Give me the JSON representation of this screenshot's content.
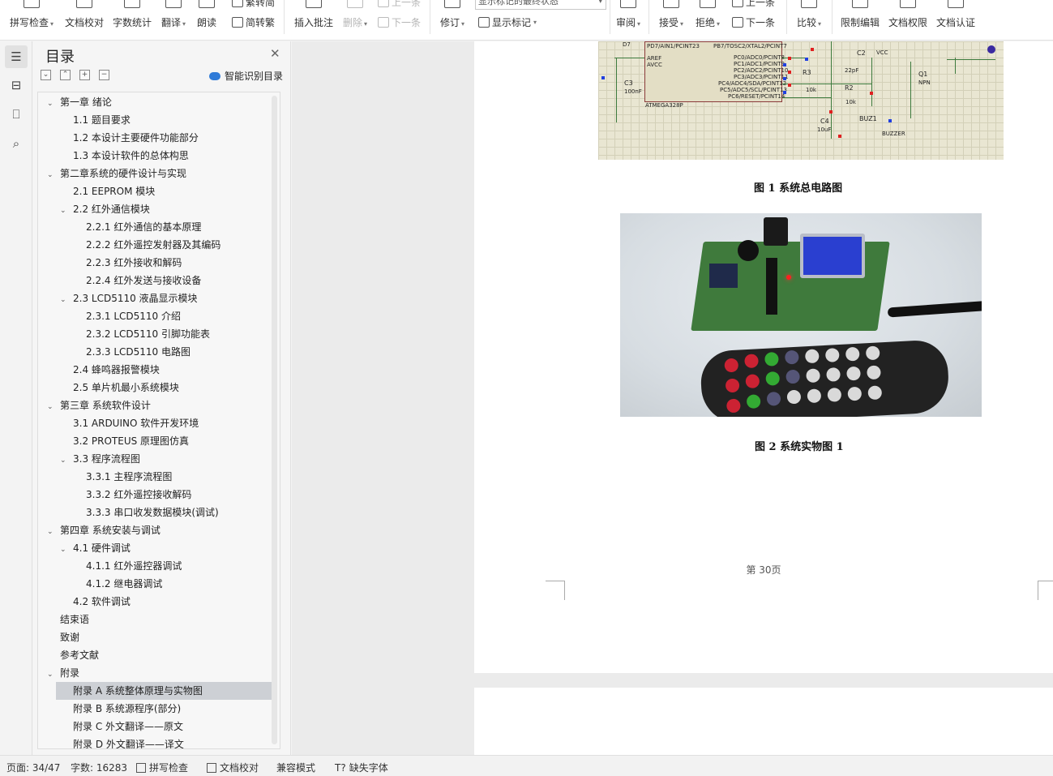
{
  "ribbon": {
    "spell_check": "拼写检查",
    "doc_proofread": "文档校对",
    "word_count": "字数统计",
    "translate": "翻译",
    "read_aloud": "朗读",
    "trad_to_simp": "繁转简",
    "simp_to_trad": "简转繁",
    "insert_comment": "插入批注",
    "delete": "删除",
    "prev_comment": "上一条",
    "next_comment": "下一条",
    "revise": "修订",
    "markup_state": "显示标记的最终状态",
    "show_markup": "显示标记",
    "review": "审阅",
    "accept": "接受",
    "reject": "拒绝",
    "prev_change": "上一条",
    "next_change": "下一条",
    "compare": "比较",
    "restrict_edit": "限制编辑",
    "doc_permission": "文档权限",
    "doc_cert": "文档认证"
  },
  "toc": {
    "title": "目录",
    "smart_toc": "智能识别目录",
    "items": [
      {
        "text": "第一章  绪论",
        "level": 0,
        "expanded": true
      },
      {
        "text": "1.1    题目要求",
        "level": 1
      },
      {
        "text": "1.2    本设计主要硬件功能部分",
        "level": 1
      },
      {
        "text": "1.3    本设计软件的总体构思",
        "level": 1
      },
      {
        "text": "第二章系统的硬件设计与实现",
        "level": 0,
        "expanded": true
      },
      {
        "text": "2.1    EEPROM 模块",
        "level": 1
      },
      {
        "text": "2.2    红外通信模块",
        "level": 1,
        "expanded": true
      },
      {
        "text": "2.2.1    红外通信的基本原理",
        "level": 2
      },
      {
        "text": "2.2.2    红外遥控发射器及其编码",
        "level": 2
      },
      {
        "text": "2.2.3    红外接收和解码",
        "level": 2
      },
      {
        "text": "2.2.4    红外发送与接收设备",
        "level": 2
      },
      {
        "text": "2.3    LCD5110 液晶显示模块",
        "level": 1,
        "expanded": true
      },
      {
        "text": "2.3.1    LCD5110 介绍",
        "level": 2
      },
      {
        "text": "2.3.2    LCD5110 引脚功能表",
        "level": 2
      },
      {
        "text": "2.3.3    LCD5110 电路图",
        "level": 2
      },
      {
        "text": "2.4      蜂鸣器报警模块",
        "level": 1
      },
      {
        "text": "2.5    单片机最小系统模块",
        "level": 1
      },
      {
        "text": "第三章  系统软件设计",
        "level": 0,
        "expanded": true
      },
      {
        "text": "3.1    ARDUINO 软件开发环境",
        "level": 1
      },
      {
        "text": "3.2    PROTEUS 原理图仿真",
        "level": 1
      },
      {
        "text": "3.3    程序流程图",
        "level": 1,
        "expanded": true
      },
      {
        "text": "3.3.1    主程序流程图",
        "level": 2
      },
      {
        "text": "3.3.2    红外遥控接收解码",
        "level": 2
      },
      {
        "text": "3.3.3    串口收发数据模块(调试)",
        "level": 2
      },
      {
        "text": "第四章  系统安装与调试",
        "level": 0,
        "expanded": true
      },
      {
        "text": "4.1    硬件调试",
        "level": 1,
        "expanded": true
      },
      {
        "text": "4.1.1 红外遥控器调试",
        "level": 2
      },
      {
        "text": "4.1.2 继电器调试",
        "level": 2
      },
      {
        "text": "4.2    软件调试",
        "level": 1
      },
      {
        "text": "结束语",
        "level": 0
      },
      {
        "text": "致谢",
        "level": 0
      },
      {
        "text": "参考文献",
        "level": 0
      },
      {
        "text": "附录",
        "level": 0,
        "expanded": true
      },
      {
        "text": "附录 A    系统整体原理与实物图",
        "level": 1,
        "selected": true
      },
      {
        "text": "附录 B    系统源程序(部分)",
        "level": 1
      },
      {
        "text": "附录 C    外文翻译——原文",
        "level": 1
      },
      {
        "text": "附录 D    外文翻译——译文",
        "level": 1
      }
    ]
  },
  "doc": {
    "fig1_caption": "图 1  系统总电路图",
    "fig2_caption": "图 2  系统实物图 1",
    "page_number": "第 30页",
    "schematic_labels": {
      "chip": "ATMEGA328P",
      "aref": "AREF",
      "avcc": "AVCC",
      "pins_left": "PD7/AIN1/PCINT23",
      "pins_right_top": "PB7/TOSC2/XTAL2/PCINT7",
      "pc0": "PC0/ADC0/PCINT8",
      "pc1": "PC1/ADC1/PCINT9",
      "pc2": "PC2/ADC2/PCINT10",
      "pc3": "PC3/ADC3/PCINT11",
      "pc4": "PC4/ADC4/SDA/PCINT12",
      "pc5": "PC5/ADC5/SCL/PCINT13",
      "pc6": "PC6/RESET/PCINT14",
      "c3": "C3",
      "c3v": "100nF",
      "r3": "R3",
      "r3v": "10k",
      "r2": "R2",
      "r2v": "10k",
      "c2": "C2",
      "c2v": "22pF",
      "c4": "C4",
      "c4v": "10uF",
      "q1": "Q1",
      "q1t": "NPN",
      "buz": "BUZ1",
      "buzt": "BUZZER",
      "vcc": "VCC",
      "d7": "D7"
    }
  },
  "status": {
    "page": "页面: 34/47",
    "words": "字数: 16283",
    "spell": "拼写检查",
    "proof": "文档校对",
    "compat": "兼容模式",
    "missing_font": "缺失字体"
  }
}
